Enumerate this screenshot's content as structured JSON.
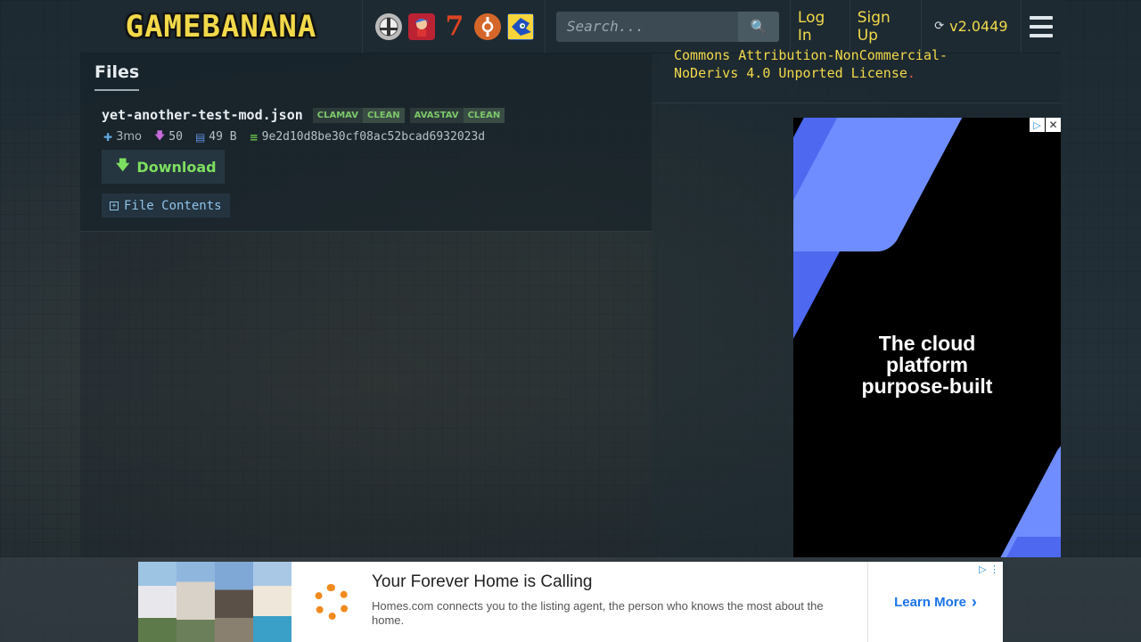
{
  "header": {
    "logo_text": "GAMEBANANA",
    "game_icons": [
      {
        "name": "smash-bros-icon",
        "glyph": ""
      },
      {
        "name": "fnf-icon",
        "glyph": ""
      },
      {
        "name": "seven-icon",
        "glyph": "7"
      },
      {
        "name": "tf2-icon",
        "glyph": ""
      },
      {
        "name": "sonic-icon",
        "glyph": ""
      }
    ],
    "search_placeholder": "Search...",
    "search_button_icon": "🔍",
    "login_label": "Log In",
    "signup_label": "Sign Up",
    "version_label": "v2.0449",
    "version_icon": "⟳"
  },
  "files": {
    "title": "Files",
    "file_name": "yet-another-test-mod.json",
    "scans": [
      {
        "engine": "CLAMAV",
        "status": "CLEAN"
      },
      {
        "engine": "AVASTAV",
        "status": "CLEAN"
      }
    ],
    "age": "3mo",
    "downloads": "50",
    "size": "49 B",
    "md5": "9e2d10d8be30cf08ac52bcad6932023d",
    "download_label": "Download",
    "contents_label": "File Contents"
  },
  "license": {
    "line1": "Commons Attribution-NonCommercial-",
    "line2": "NoDerivs 4.0 Unported License",
    "dot": "."
  },
  "side_ad": {
    "headline_l1": "The cloud",
    "headline_l2": "platform",
    "headline_l3": "purpose-built",
    "colors": {
      "background": "#000000",
      "shape_light": "#6f8dff",
      "shape_dark": "#4e69f0"
    }
  },
  "bottom_ad": {
    "title": "Your Forever Home is Calling",
    "description": "Homes.com connects you to the listing agent, the person who knows the most about the home.",
    "cta": "Learn More",
    "cta_icon": "›"
  },
  "colors": {
    "accent_yellow": "#f2d94a",
    "clean_green": "#7cc86a",
    "download_green": "#7ddf5f",
    "link_blue": "#8ec3e6"
  }
}
